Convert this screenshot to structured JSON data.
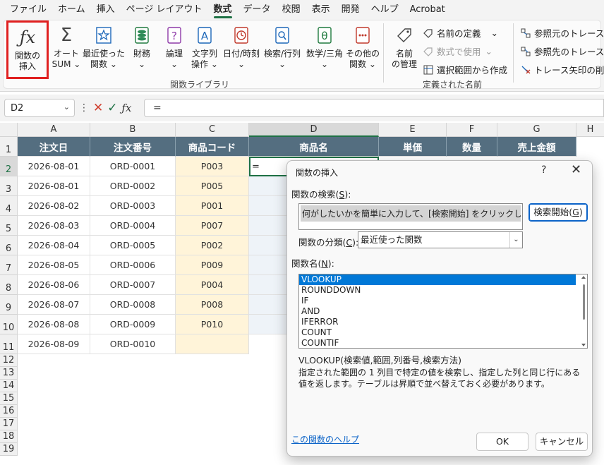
{
  "menu": {
    "tabs": [
      "ファイル",
      "ホーム",
      "挿入",
      "ページ レイアウト",
      "数式",
      "データ",
      "校閲",
      "表示",
      "開発",
      "ヘルプ",
      "Acrobat"
    ],
    "active": "数式"
  },
  "ribbon": {
    "insert_function": {
      "line1": "関数の",
      "line2": "挿入"
    },
    "autosum": {
      "line1": "オート",
      "line2": "SUM"
    },
    "recent": {
      "line1": "最近使った",
      "line2": "関数"
    },
    "financial": {
      "line1": "財務"
    },
    "logical": {
      "line1": "論理"
    },
    "text": {
      "line1": "文字列",
      "line2": "操作"
    },
    "datetime": {
      "line1": "日付/時刻"
    },
    "lookup": {
      "line1": "検索/行列"
    },
    "math": {
      "line1": "数学/三角"
    },
    "more": {
      "line1": "その他の",
      "line2": "関数"
    },
    "group_function_library": "関数ライブラリ",
    "name_manager": {
      "line1": "名前",
      "line2": "の管理"
    },
    "define_name": "名前の定義",
    "use_in_formula": "数式で使用",
    "create_from_selection": "選択範囲から作成",
    "group_defined_names": "定義された名前",
    "trace_precedents": "参照元のトレース",
    "trace_dependents": "参照先のトレース",
    "remove_arrows": "トレース矢印の削除"
  },
  "formula_bar": {
    "name_box": "D2",
    "formula": "="
  },
  "grid": {
    "columns": [
      "A",
      "B",
      "C",
      "D",
      "E",
      "F",
      "G",
      "H"
    ],
    "headers": [
      "注文日",
      "注文番号",
      "商品コード",
      "商品名",
      "単価",
      "数量",
      "売上金額"
    ],
    "rows": [
      {
        "date": "2026-08-01",
        "order": "ORD-0001",
        "code": "P003"
      },
      {
        "date": "2026-08-01",
        "order": "ORD-0002",
        "code": "P005"
      },
      {
        "date": "2026-08-02",
        "order": "ORD-0003",
        "code": "P001"
      },
      {
        "date": "2026-08-03",
        "order": "ORD-0004",
        "code": "P007"
      },
      {
        "date": "2026-08-04",
        "order": "ORD-0005",
        "code": "P002"
      },
      {
        "date": "2026-08-05",
        "order": "ORD-0006",
        "code": "P009"
      },
      {
        "date": "2026-08-06",
        "order": "ORD-0007",
        "code": "P004"
      },
      {
        "date": "2026-08-07",
        "order": "ORD-0008",
        "code": "P008"
      },
      {
        "date": "2026-08-08",
        "order": "ORD-0009",
        "code": "P010"
      },
      {
        "date": "2026-08-09",
        "order": "ORD-0010",
        "code": ""
      }
    ],
    "row_numbers": [
      "1",
      "2",
      "3",
      "4",
      "5",
      "6",
      "7",
      "8",
      "9",
      "10",
      "11",
      "12",
      "13",
      "14",
      "15",
      "16",
      "17",
      "18",
      "19"
    ],
    "active_cell_value": "="
  },
  "dialog": {
    "title": "関数の挿入",
    "help_q": "?",
    "close": "✕",
    "search_label": "関数の検索(",
    "search_key": "S",
    "search_label_end": "):",
    "search_text": "何がしたいかを簡単に入力して、[検索開始] をクリックしてください。",
    "search_button": "検索開始(",
    "search_button_key": "G",
    "search_button_end": ")",
    "category_label": "関数の分類(",
    "category_key": "C",
    "category_label_end": "):",
    "category_value": "最近使った関数",
    "list_label": "関数名(",
    "list_key": "N",
    "list_label_end": "):",
    "functions": [
      "VLOOKUP",
      "ROUNDDOWN",
      "IF",
      "AND",
      "IFERROR",
      "COUNT",
      "COUNTIF"
    ],
    "selected_function": "VLOOKUP",
    "syntax": "VLOOKUP(検索値,範囲,列番号,検索方法)",
    "description": "指定された範囲の 1 列目で特定の値を検索し、指定した列と同じ行にある値を返します。テーブルは昇順で並べ替えておく必要があります。",
    "help_link": "この関数のヘルプ",
    "ok": "OK",
    "cancel": "キャンセル"
  }
}
